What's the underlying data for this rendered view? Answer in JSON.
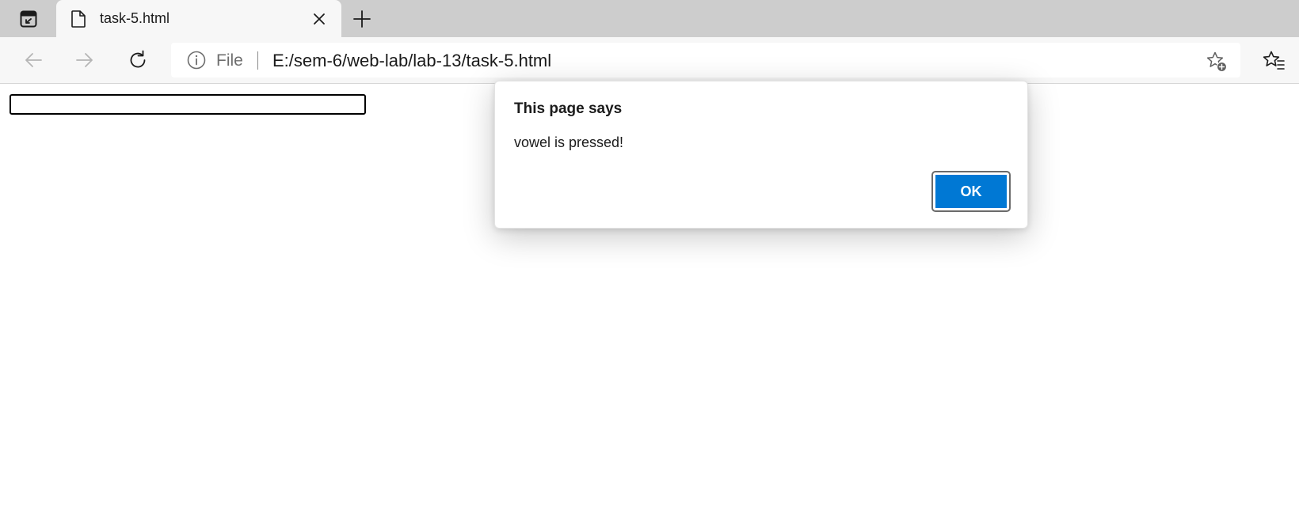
{
  "browser": {
    "tab": {
      "title": "task-5.html"
    },
    "address_bar": {
      "scheme_label": "File",
      "url": "E:/sem-6/web-lab/lab-13/task-5.html"
    },
    "icons": {
      "tab_actions": "tab-actions-icon",
      "page": "page-icon",
      "close": "close-icon",
      "new_tab": "plus-icon",
      "back": "back-arrow-icon",
      "forward": "forward-arrow-icon",
      "reload": "reload-icon",
      "site_info": "info-icon",
      "add_favorite": "star-plus-icon",
      "favorites": "favorites-icon"
    }
  },
  "page": {
    "text_input": {
      "value": ""
    }
  },
  "alert_dialog": {
    "title": "This page says",
    "message": "vowel is pressed!",
    "ok_label": "OK"
  },
  "colors": {
    "accent": "#0078d4",
    "tabstrip": "#cdcdcd",
    "toolbar": "#f7f7f7"
  }
}
